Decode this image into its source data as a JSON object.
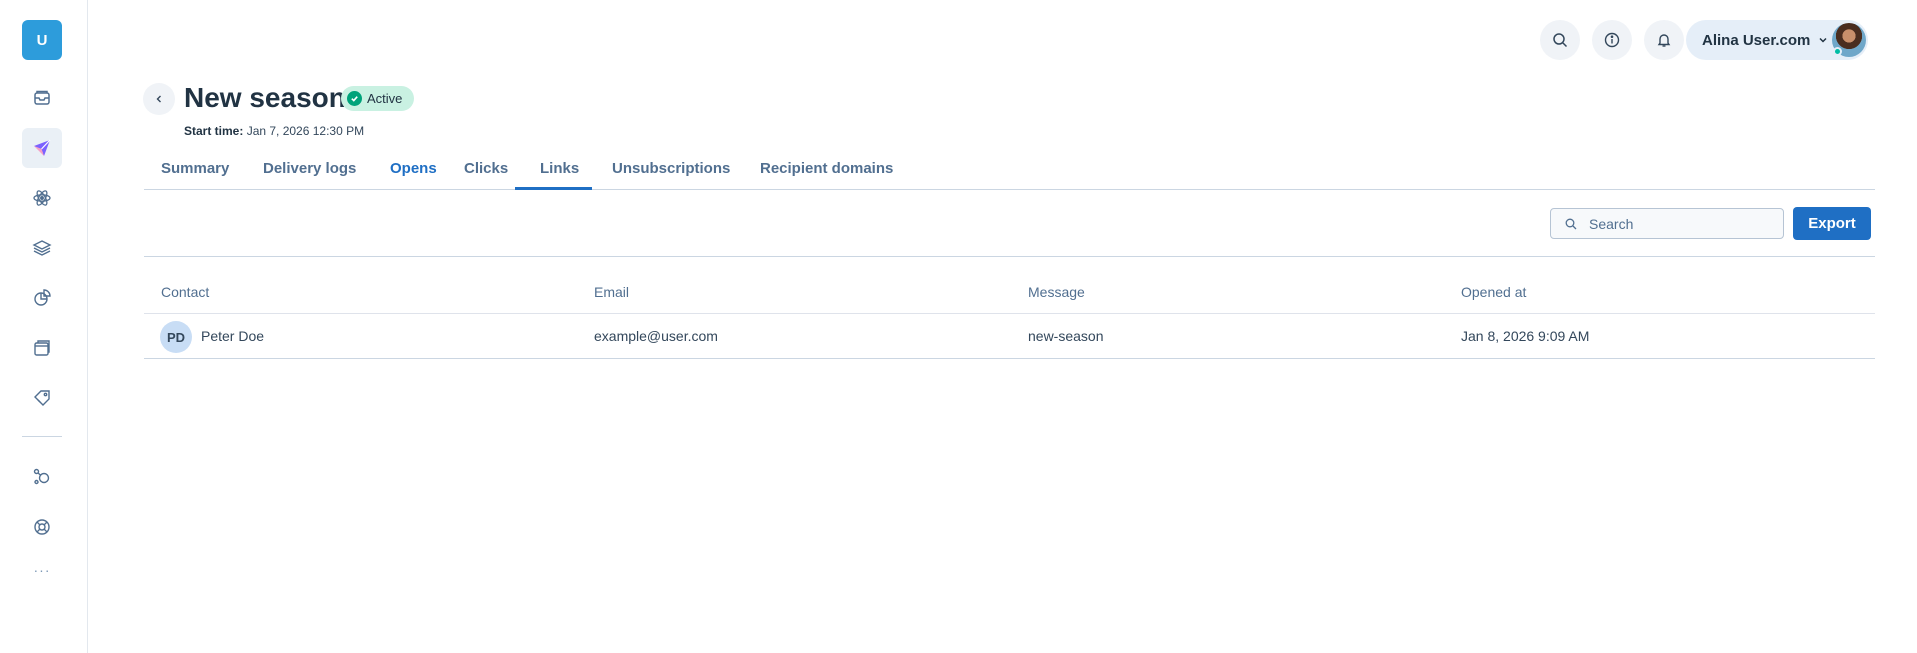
{
  "app": {
    "logo_letter": "U",
    "more_label": "···"
  },
  "sidebar": {
    "items": [
      {
        "icon": "inbox-icon"
      },
      {
        "icon": "send-icon",
        "active": true
      },
      {
        "icon": "atom-icon"
      },
      {
        "icon": "layers-icon"
      },
      {
        "icon": "chart-pie-icon"
      },
      {
        "icon": "windows-icon"
      },
      {
        "icon": "tag-icon"
      },
      {
        "icon": "integration-icon"
      },
      {
        "icon": "support-icon"
      }
    ]
  },
  "header": {
    "user_name": "Alina User.com"
  },
  "page": {
    "title": "New season",
    "status": "Active",
    "start_time_label": "Start time:",
    "start_time_value": "Jan 7, 2026 12:30 PM"
  },
  "tabs": [
    {
      "label": "Summary"
    },
    {
      "label": "Delivery logs"
    },
    {
      "label": "Opens",
      "active": true
    },
    {
      "label": "Clicks"
    },
    {
      "label": "Links"
    },
    {
      "label": "Unsubscriptions"
    },
    {
      "label": "Recipient domains"
    }
  ],
  "toolbar": {
    "search_placeholder": "Search",
    "export_label": "Export"
  },
  "table": {
    "columns": [
      "Contact",
      "Email",
      "Message",
      "Opened at"
    ],
    "rows": [
      {
        "initials": "PD",
        "contact": "Peter Doe",
        "email": "example@user.com",
        "message": "new-season",
        "opened_at": "Jan 8, 2026 9:09 AM"
      }
    ]
  },
  "colors": {
    "accent": "#1f6fc4",
    "logo": "#2d9cdb",
    "status_bg": "#c9f1e2",
    "status_check": "#00a37a"
  }
}
